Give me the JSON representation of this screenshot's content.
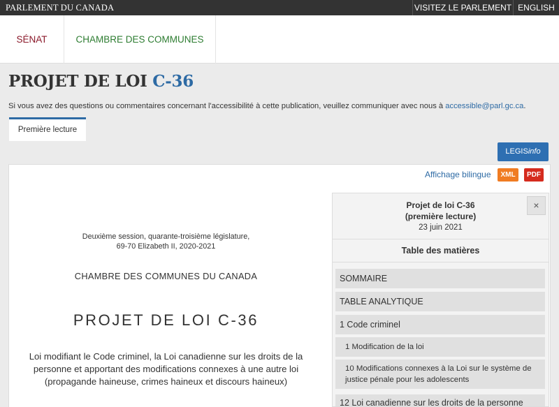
{
  "topbar": {
    "brand": "PARLEMENT DU CANADA",
    "visit": "VISITEZ LE PARLEMENT",
    "language": "ENGLISH"
  },
  "chambers": {
    "senate": "SÉNAT",
    "commons": "CHAMBRE DES COMMUNES"
  },
  "page": {
    "title_prefix": "PROJET DE LOI",
    "title_number": "C-36",
    "access_text": "Si vous avez des questions ou commentaires concernant l'accessibilité à cette publication, veuillez communiquer avec nous à",
    "access_email": "accessible@parl.gc.ca",
    "access_end": ".",
    "tab": "Première lecture"
  },
  "toolbar": {
    "legis_prefix": "LEGIS",
    "legis_suffix": "info",
    "bilingual": "Affichage bilingue",
    "xml": "XML",
    "pdf": "PDF"
  },
  "document": {
    "session_line1": "Deuxième session, quarante-troisième législature,",
    "session_line2": "69-70 Elizabeth II, 2020-2021",
    "house": "CHAMBRE DES COMMUNES DU CANADA",
    "bill_title": "PROJET DE LOI C-36",
    "description": "Loi modifiant le Code criminel, la Loi canadienne sur les droits de la personne et apportant des modifications connexes à une autre loi (propagande haineuse, crimes haineux et discours haineux)"
  },
  "toc": {
    "header_line1": "Projet de loi C-36",
    "header_line2": "(première lecture)",
    "header_date": "23 juin 2021",
    "close_icon": "×",
    "label": "Table des matières",
    "items": [
      "SOMMAIRE",
      "TABLE ANALYTIQUE",
      "1 Code criminel",
      "1 Modification de la loi",
      "10 Modifications connexes à la Loi sur le système de justice pénale pour les adolescents",
      "12 Loi canadienne sur les droits de la personne"
    ]
  },
  "colors": {
    "topbar": "#333333",
    "senate": "#8b1a2b",
    "commons": "#2e7d32",
    "link_blue": "#2d6aa4",
    "legis_button": "#2e6fb2",
    "xml_button": "#f07c22",
    "pdf_button": "#d52b1e"
  }
}
